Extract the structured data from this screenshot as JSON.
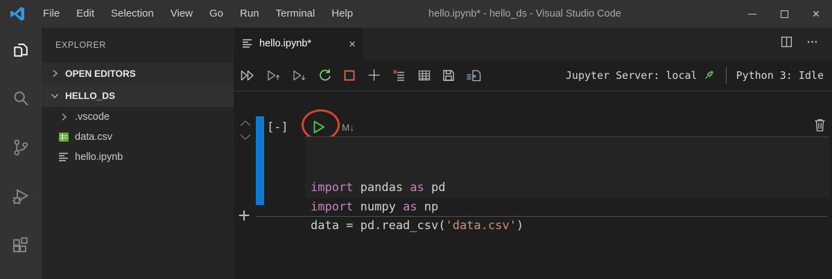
{
  "titlebar": {
    "menus": [
      "File",
      "Edit",
      "Selection",
      "View",
      "Go",
      "Run",
      "Terminal",
      "Help"
    ],
    "title": "hello.ipynb* - hello_ds - Visual Studio Code",
    "close_glyph": "✕"
  },
  "activity_bar": {
    "items": [
      "explorer",
      "search",
      "source-control",
      "run-debug",
      "extensions"
    ],
    "active": "explorer"
  },
  "sidebar": {
    "header": "EXPLORER",
    "sections": {
      "open_editors": "OPEN EDITORS",
      "workspace": "HELLO_DS"
    },
    "files": [
      {
        "label": ".vscode",
        "icon": "folder-collapsed"
      },
      {
        "label": "data.csv",
        "icon": "csv"
      },
      {
        "label": "hello.ipynb",
        "icon": "notebook"
      }
    ]
  },
  "editor": {
    "tab": {
      "label": "hello.ipynb*",
      "close_glyph": "×",
      "icon": "notebook"
    },
    "toolbar": {
      "icons": [
        "run-all",
        "run-above",
        "run-below",
        "restart-kernel",
        "interrupt-kernel",
        "add-cell",
        "clear-outputs",
        "variable-explorer",
        "save",
        "export"
      ],
      "jupyter_server": "Jupyter Server: local",
      "kernel_status": "Python 3: Idle"
    }
  },
  "cell": {
    "collapse_label": "[-]",
    "markdown_hint": "M↓",
    "add_cell_glyph": "+",
    "code_lines": [
      [
        {
          "text": "import",
          "type": "kw"
        },
        {
          "text": " pandas ",
          "type": "pl"
        },
        {
          "text": "as",
          "type": "kw"
        },
        {
          "text": " pd",
          "type": "pl"
        }
      ],
      [
        {
          "text": "import",
          "type": "kw"
        },
        {
          "text": " numpy ",
          "type": "pl"
        },
        {
          "text": "as",
          "type": "kw"
        },
        {
          "text": " np",
          "type": "pl"
        }
      ],
      [
        {
          "text": "data = pd.read_csv(",
          "type": "pl"
        },
        {
          "text": "'data.csv'",
          "type": "str"
        },
        {
          "text": ")",
          "type": "pl"
        }
      ]
    ]
  },
  "colors": {
    "selection_bar": "#0e7ad1",
    "keyword": "#C586C0",
    "string": "#CE9178",
    "run_green": "#54c158",
    "restart_green": "#84d184",
    "interrupt_red": "#ef6a5a",
    "annotation_red": "#d8472b",
    "csv_green": "#5fae3a",
    "jupyter_connected": "#6ec06e"
  }
}
